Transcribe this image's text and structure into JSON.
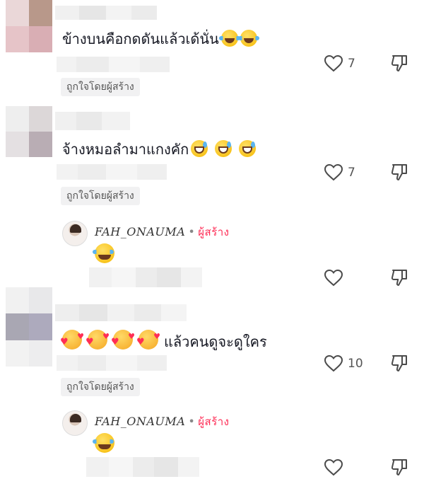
{
  "comments": [
    {
      "text": "ข้างบนคือกดดันแล้วเด้นั่น",
      "emoji_suffix": [
        "laughing-tears-icon",
        "laughing-tears-icon"
      ],
      "liked_by_creator": "ถูกใจโดยผู้สร้าง",
      "likes": "7"
    },
    {
      "text": "จ้างหมอลำมาแกงคัก",
      "emoji_suffix": [
        "sweat-smile-icon",
        "sweat-smile-icon",
        "sweat-smile-icon"
      ],
      "liked_by_creator": "ถูกใจโดยผู้สร้าง",
      "likes": "7",
      "reply": {
        "author": "FAH_ONAUMA",
        "separator": "•",
        "creator_badge": "ผู้สร้าง",
        "emoji": "laughing-tears-icon",
        "likes": ""
      }
    },
    {
      "text": "แล้วคนดูจะดูใคร",
      "emoji_prefix": [
        "smiling-face-with-hearts-icon",
        "smiling-face-with-hearts-icon",
        "smiling-face-with-hearts-icon",
        "smiling-face-with-hearts-icon"
      ],
      "liked_by_creator": "ถูกใจโดยผู้สร้าง",
      "likes": "10",
      "reply": {
        "author": "FAH_ONAUMA",
        "separator": "•",
        "creator_badge": "ผู้สร้าง",
        "emoji": "laughing-tears-icon",
        "likes": ""
      }
    }
  ],
  "colors": {
    "text": "#161823",
    "creator_accent": "#fe2c55",
    "chip_bg": "#f1f1f2",
    "icon": "#4a4a4a"
  }
}
